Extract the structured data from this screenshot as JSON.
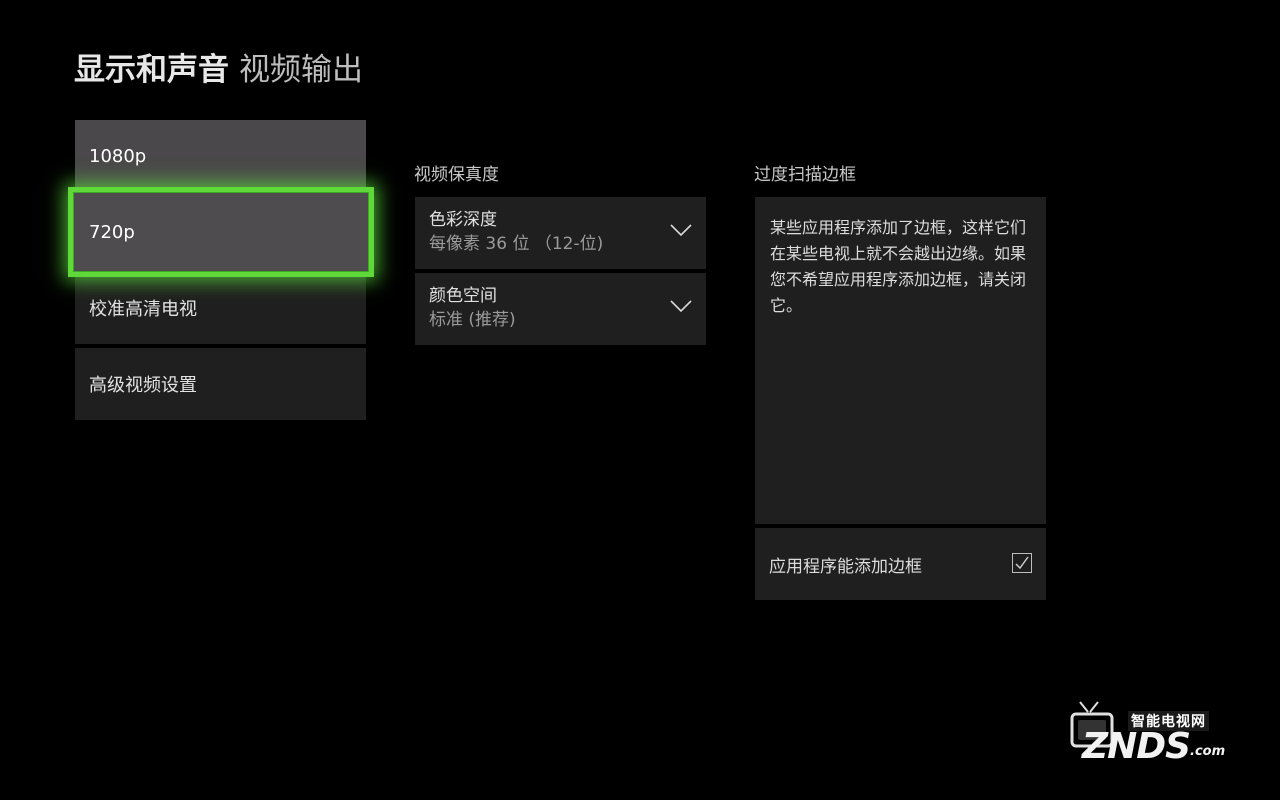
{
  "header": {
    "title": "显示和声音",
    "subtitle": "视频输出"
  },
  "resolution_menu": {
    "items": [
      {
        "label": "1080p"
      },
      {
        "label": "720p"
      },
      {
        "label": "校准高清电视"
      },
      {
        "label": "高级视频设置"
      }
    ],
    "focused": "720p"
  },
  "video_fidelity": {
    "header": "视频保真度",
    "dropdowns": [
      {
        "label": "色彩深度",
        "value": "每像素 36 位 （12-位)"
      },
      {
        "label": "颜色空间",
        "value": "标准 (推荐)"
      }
    ]
  },
  "overscan": {
    "header": "过度扫描边框",
    "description": "某些应用程序添加了边框，这样它们在某些电视上就不会越出边缘。如果您不希望应用程序添加边框，请关闭它。",
    "checkbox_label": "应用程序能添加边框",
    "checkbox_checked": true
  },
  "watermark": {
    "cn_text": "智能电视网",
    "logo": "ZNDS",
    "domain": ".com"
  },
  "colors": {
    "focus_accent": "#5fd93a",
    "background": "#000000",
    "panel": "#1f1f1f"
  }
}
